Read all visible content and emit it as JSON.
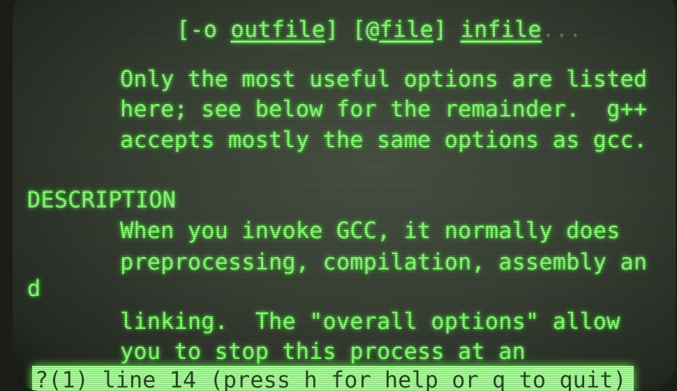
{
  "synopsis": {
    "open1": "[-o ",
    "outfile": "outfile",
    "close1": "] [@",
    "file": "file",
    "close2": "] ",
    "infile": "infile",
    "ellipsis": "..."
  },
  "intro_lines": [
    "Only the most useful options are listed",
    "here; see below for the remainder.  g++",
    "accepts mostly the same options as gcc."
  ],
  "section_heading": "DESCRIPTION",
  "description_lines": [
    "When you invoke GCC, it normally does",
    "preprocessing, compilation, assembly an",
    "d",
    "linking.  The \"overall options\" allow",
    "you to stop this process at an"
  ],
  "status_bar": "?(1) line 14 (press h for help or q to quit)",
  "colors": {
    "phosphor": "#8dff7a",
    "background": "#3a4236",
    "status_bg": "#a8ff98"
  }
}
